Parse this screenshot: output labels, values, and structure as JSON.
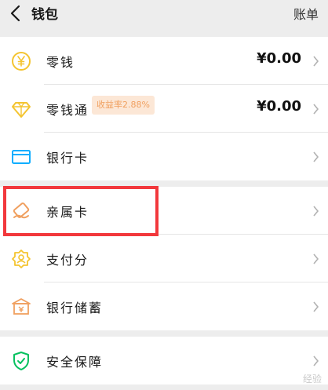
{
  "header": {
    "title": "钱包",
    "bill_label": "账单"
  },
  "groups": [
    {
      "items": [
        {
          "name": "change",
          "label": "零钱",
          "amount": "¥0.00",
          "icon": "yen-coin-icon"
        },
        {
          "name": "licaitong",
          "label": "零钱通",
          "badge": "收益率2.88%",
          "amount": "¥0.00",
          "icon": "diamond-icon"
        },
        {
          "name": "bank-card",
          "label": "银行卡",
          "icon": "bank-card-icon"
        }
      ]
    },
    {
      "items": [
        {
          "name": "family-card",
          "label": "亲属卡",
          "icon": "family-card-icon"
        },
        {
          "name": "payscore",
          "label": "支付分",
          "icon": "payscore-badge-icon"
        },
        {
          "name": "bank-savings",
          "label": "银行储蓄",
          "icon": "bank-building-icon"
        }
      ]
    },
    {
      "items": [
        {
          "name": "security",
          "label": "安全保障",
          "icon": "shield-check-icon"
        }
      ]
    }
  ],
  "colors": {
    "icon_yellow": "#f4c430",
    "icon_blue": "#10aeff",
    "icon_orange": "#f0a060",
    "icon_green": "#07c160",
    "highlight_red": "#f2383c"
  },
  "watermark": "经验"
}
